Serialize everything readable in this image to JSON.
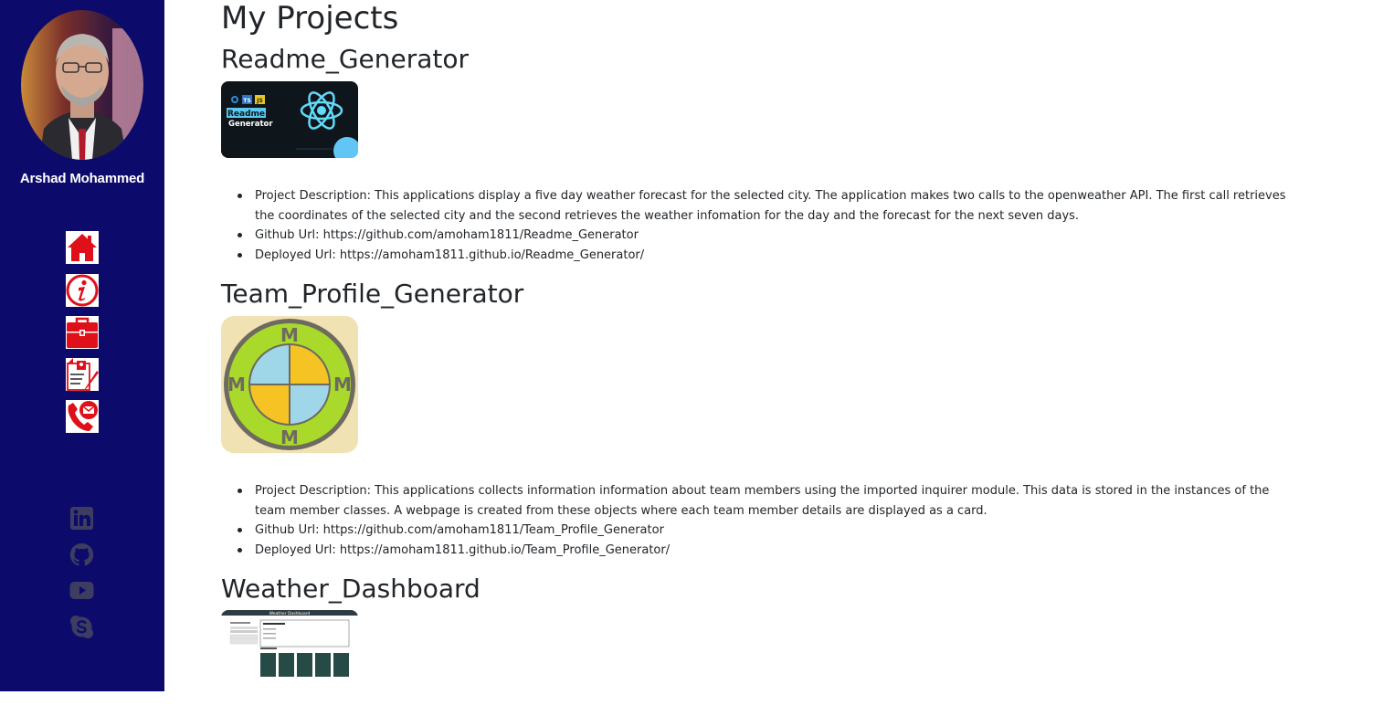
{
  "sidebar": {
    "owner_name": "Arshad Mohammed",
    "background": "#0c0a6b",
    "nav": [
      {
        "icon": "home-icon",
        "color": "#e0101a"
      },
      {
        "icon": "info-icon",
        "color": "#e0101a"
      },
      {
        "icon": "briefcase-icon",
        "color": "#e0101a"
      },
      {
        "icon": "resume-icon",
        "color": "#e0101a"
      },
      {
        "icon": "contact-icon",
        "color": "#e0101a"
      }
    ],
    "social": [
      {
        "icon": "linkedin-icon",
        "color": "#3d3d62"
      },
      {
        "icon": "github-icon",
        "color": "#3d3d62"
      },
      {
        "icon": "youtube-icon",
        "color": "#3d3d62"
      },
      {
        "icon": "skype-icon",
        "color": "#3d3d62"
      }
    ]
  },
  "main": {
    "page_title": "My Projects",
    "projects": [
      {
        "title": "Readme_Generator",
        "thumbnail": {
          "icon": "react-logo-icon",
          "text": "Readme",
          "text2": "Generator",
          "badges": [
            "TS",
            "JS"
          ]
        },
        "description": "Project Description: This applications display a five day weather forecast for the selected city. The application makes two calls to the openweather API. The first call retrieves the coordinates of the selected city and the second retrieves the weather infomation for the day and the forecast for the next seven days.",
        "github": "Github Url: https://github.com/amoham1811/Readme_Generator",
        "deployed": "Deployed Url: https://amoham1811.github.io/Readme_Generator/"
      },
      {
        "title": "Team_Profile_Generator",
        "thumbnail": {
          "icon": "mmmm-logo-icon",
          "letter": "M"
        },
        "description": "Project Description: This applications collects information information about team members using the imported inquirer module. This data is stored in the instances of the team member classes. A webpage is created from these objects where each team member details are displayed as a card.",
        "github": "Github Url: https://github.com/amoham1811/Team_Profile_Generator",
        "deployed": "Deployed Url: https://amoham1811.github.io/Team_Profile_Generator/"
      },
      {
        "title": "Weather_Dashboard",
        "thumbnail": {
          "icon": "weather-dashboard-screenshot-icon",
          "header": "Weather Dashboard"
        }
      }
    ]
  }
}
